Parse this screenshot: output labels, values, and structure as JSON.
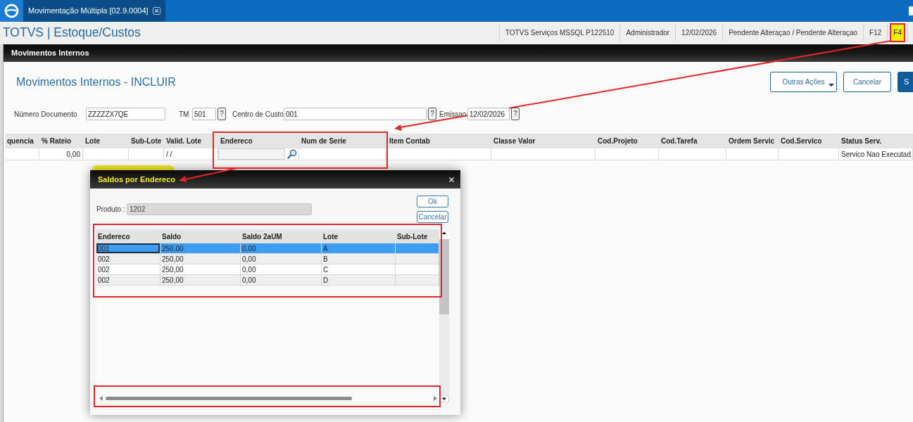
{
  "app_tab": {
    "title": "Movimentação Múltipla [02.9.0004]"
  },
  "header": {
    "title": "TOTVS | Estoque/Custos",
    "status_items": [
      {
        "label": "TOTVS Serviços MSSQL P122510",
        "highlighted": false
      },
      {
        "label": "Administrador",
        "highlighted": false
      },
      {
        "label": "12/02/2026",
        "highlighted": false
      },
      {
        "label": "Pendente Alteraçao / Pendente Alteraçao",
        "highlighted": false
      },
      {
        "label": "F12",
        "highlighted": false
      },
      {
        "label": "F4",
        "highlighted": true
      }
    ]
  },
  "panel": {
    "title": "Movimentos Internos"
  },
  "form": {
    "title": "Movimentos Internos - INCLUIR",
    "buttons": [
      {
        "label": "Outras Ações",
        "kind": "menu"
      },
      {
        "label": "Cancelar",
        "kind": "outline"
      },
      {
        "label": "S",
        "kind": "primary"
      }
    ],
    "fields": [
      {
        "label": "Número Documento",
        "value": "ZZZZZX7QE"
      },
      {
        "label": "TM",
        "value": "501",
        "help": "?"
      },
      {
        "label": "Centro de Custo",
        "value": "001",
        "help": "?"
      },
      {
        "label": "Emissao",
        "value": "12/02/2026",
        "help": "?"
      }
    ]
  },
  "grid": {
    "columns": [
      {
        "label": "quencia",
        "kind": "text"
      },
      {
        "label": "% Rateio",
        "kind": "number",
        "value": "0,00"
      },
      {
        "label": "Lote",
        "kind": "text"
      },
      {
        "label": "Sub-Lote",
        "kind": "text"
      },
      {
        "label": "Valid. Lote",
        "kind": "text",
        "value": "/ /"
      },
      {
        "label": "Endereco",
        "kind": "lookup"
      },
      {
        "label": "Num de Serie",
        "kind": "text"
      },
      {
        "label": "Item Contab",
        "kind": "text"
      },
      {
        "label": "Classe Valor",
        "kind": "text"
      },
      {
        "label": "Cod.Projeto",
        "kind": "text"
      },
      {
        "label": "Cod.Tarefa",
        "kind": "text"
      },
      {
        "label": "Ordem Servic",
        "kind": "text"
      },
      {
        "label": "Cod.Servico",
        "kind": "text"
      },
      {
        "label": "Status Serv.",
        "kind": "text",
        "value": "Servico Nao Executad"
      }
    ]
  },
  "dialog": {
    "title": "Saldos por Endereco",
    "title_highlighted": true,
    "product": {
      "label": "Produto :",
      "value": "1202"
    },
    "buttons": [
      "Ok",
      "Cancelar"
    ],
    "table": {
      "columns": [
        "Endereco",
        "Saldo",
        "Saldo 2aUM",
        "Lote",
        "Sub-Lote"
      ],
      "rows": [
        {
          "cells": [
            "001",
            "250,00",
            "0,00",
            "A"
          ],
          "selected": true
        },
        {
          "cells": [
            "002",
            "250,00",
            "0,00",
            "B"
          ],
          "selected": false
        },
        {
          "cells": [
            "002",
            "250,00",
            "0,00",
            "C"
          ],
          "selected": false
        },
        {
          "cells": [
            "002",
            "250,00",
            "0,00",
            "D"
          ],
          "selected": false
        }
      ]
    }
  }
}
